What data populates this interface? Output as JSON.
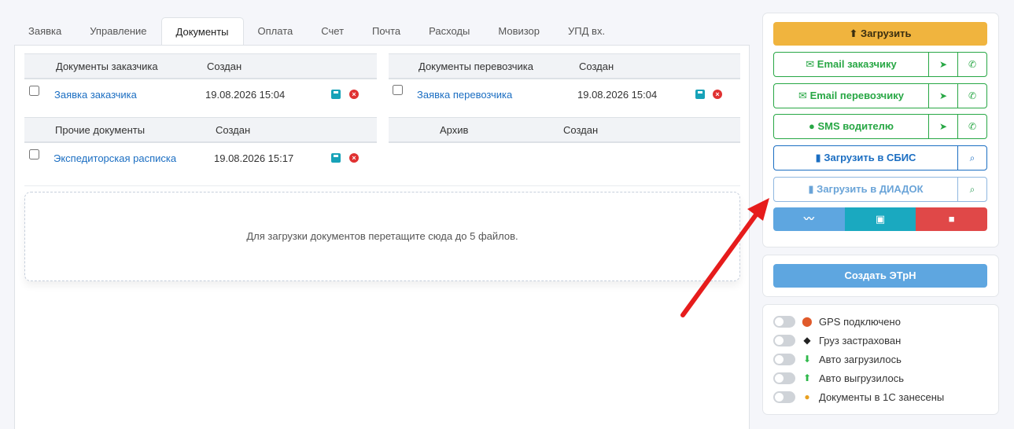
{
  "tabs": [
    "Заявка",
    "Управление",
    "Документы",
    "Оплата",
    "Счет",
    "Почта",
    "Расходы",
    "Мовизор",
    "УПД вх."
  ],
  "customer_docs": {
    "header": "Документы заказчика",
    "created_header": "Создан",
    "row": {
      "name": "Заявка заказчика",
      "date": "19.08.2026 15:04"
    }
  },
  "carrier_docs": {
    "header": "Документы перевозчика",
    "created_header": "Создан",
    "row": {
      "name": "Заявка перевозчика",
      "date": "19.08.2026 15:04"
    }
  },
  "other_docs": {
    "header": "Прочие документы",
    "created_header": "Создан",
    "row": {
      "name": "Экспедиторская расписка",
      "date": "19.08.2026 15:17"
    }
  },
  "archive": {
    "header": "Архив",
    "created_header": "Создан"
  },
  "dropzone_text": "Для загрузки документов перетащите сюда до 5 файлов.",
  "actions": {
    "upload": "Загрузить",
    "email_customer": "Email заказчику",
    "email_carrier": "Email перевозчику",
    "sms_driver": "SMS водителю",
    "upload_sbis": "Загрузить в СБИС",
    "upload_diadoc": "Загрузить в ДИАДОК"
  },
  "create_etrn": "Создать ЭТрН",
  "statuses": [
    {
      "label": "GPS подключено",
      "icon": "pin-icon"
    },
    {
      "label": "Груз застрахован",
      "icon": "shield-icon"
    },
    {
      "label": "Авто загрузилось",
      "icon": "download-icon"
    },
    {
      "label": "Авто выгрузилось",
      "icon": "upload-icon"
    },
    {
      "label": "Документы в 1С занесены",
      "icon": "onec-icon"
    }
  ],
  "colors": {
    "accent": "#1b6ec2",
    "success": "#28a745",
    "warning": "#f0b43e",
    "danger": "#e03131",
    "arrow": "#e61c1c"
  }
}
